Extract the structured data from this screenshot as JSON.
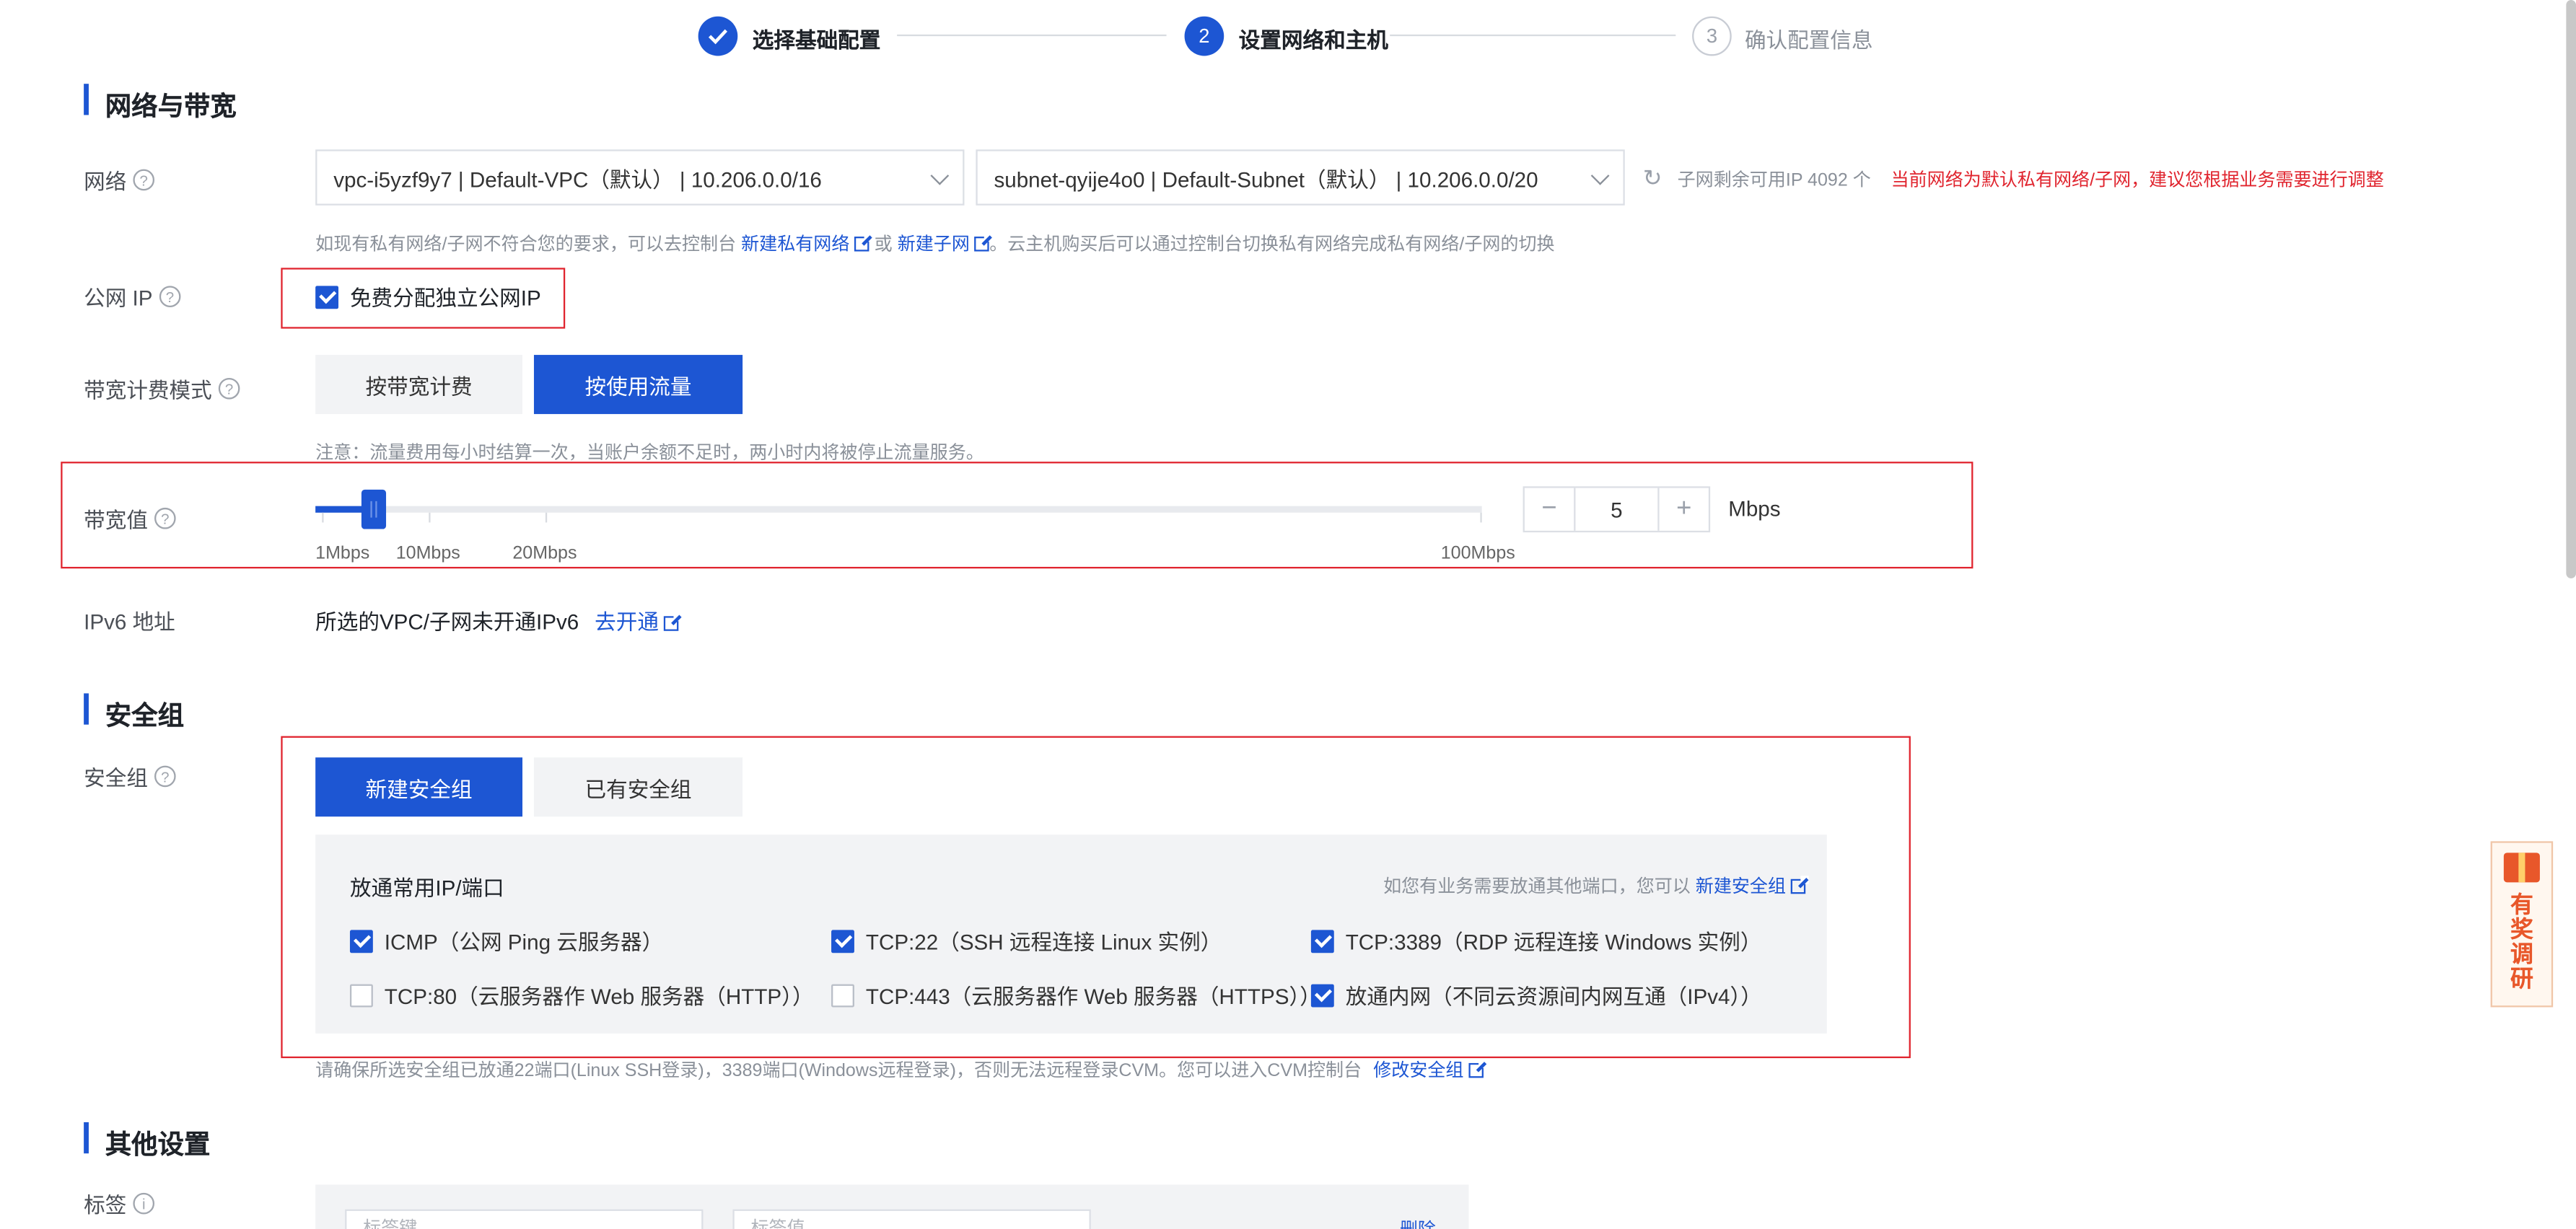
{
  "steps": [
    {
      "label": "选择基础配置",
      "state": "done"
    },
    {
      "label": "设置网络和主机",
      "number": "2",
      "state": "active"
    },
    {
      "label": "确认配置信息",
      "number": "3",
      "state": "todo"
    }
  ],
  "network_section": {
    "title": "网络与带宽",
    "network_label": "网络",
    "vpc_value": "vpc-i5yzf9y7 | Default-VPC（默认） | 10.206.0.0/16",
    "subnet_value": "subnet-qyije4o0 | Default-Subnet（默认） | 10.206.0.0/20",
    "subnet_remaining": "子网剩余可用IP 4092 个",
    "warning": "当前网络为默认私有网络/子网，建议您根据业务需要进行调整",
    "hint_prefix": "如现有私有网络/子网不符合您的要求，可以去控制台",
    "hint_link1": "新建私有网络",
    "hint_or": "或",
    "hint_link2": "新建子网",
    "hint_suffix": "。云主机购买后可以通过控制台切换私有网络完成私有网络/子网的切换",
    "public_ip_label": "公网 IP",
    "public_ip_checkbox": "免费分配独立公网IP",
    "public_ip_checked": true,
    "billing_label": "带宽计费模式",
    "billing_option1": "按带宽计费",
    "billing_option2": "按使用流量",
    "billing_selected": "按使用流量",
    "billing_note": "注意：流量费用每小时结算一次，当账户余额不足时，两小时内将被停止流量服务。",
    "bandwidth_label": "带宽值",
    "bandwidth_ticks": [
      "1Mbps",
      "10Mbps",
      "20Mbps",
      "100Mbps"
    ],
    "bandwidth_value": "5",
    "bandwidth_unit": "Mbps",
    "bandwidth_min": 1,
    "bandwidth_max": 100,
    "minus": "−",
    "plus": "+",
    "ipv6_label": "IPv6 地址",
    "ipv6_text": "所选的VPC/子网未开通IPv6",
    "ipv6_link": "去开通"
  },
  "security_section": {
    "title": "安全组",
    "label": "安全组",
    "tab_new": "新建安全组",
    "tab_existing": "已有安全组",
    "panel_title": "放通常用IP/端口",
    "panel_hint": "如您有业务需要放通其他端口，您可以",
    "panel_hint_link": "新建安全组",
    "rules": [
      {
        "text": "ICMP（公网 Ping 云服务器）",
        "checked": true
      },
      {
        "text": "TCP:22（SSH 远程连接 Linux 实例）",
        "checked": true
      },
      {
        "text": "TCP:3389（RDP 远程连接 Windows 实例）",
        "checked": true
      },
      {
        "text": "TCP:80（云服务器作 Web 服务器（HTTP））",
        "checked": false
      },
      {
        "text": "TCP:443（云服务器作 Web 服务器（HTTPS））",
        "checked": false
      },
      {
        "text": "放通内网（不同云资源间内网互通（IPv4））",
        "checked": true
      }
    ],
    "footer_note": "请确保所选安全组已放通22端口(Linux SSH登录)，3389端口(Windows远程登录)，否则无法远程登录CVM。您可以进入CVM控制台",
    "footer_link": "修改安全组"
  },
  "other_section": {
    "title": "其他设置",
    "tag_label": "标签",
    "tag_key_placeholder": "标签键",
    "tag_value_placeholder": "标签值",
    "tag_delete": "删除"
  },
  "survey": {
    "label": "有奖调研"
  },
  "colors": {
    "primary": "#1d56d3",
    "warning": "#e0242e",
    "highlight_box": "#e0242e"
  }
}
